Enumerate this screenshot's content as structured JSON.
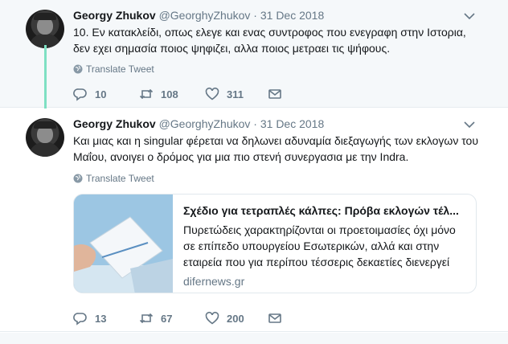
{
  "tweets": [
    {
      "name": "Georgy Zhukov",
      "handle": "@GeorghyZhukov",
      "separator": "·",
      "date": "31 Dec 2018",
      "text": "10. Εν κατακλείδι, οπως ελεγε και ενας συντροφος που ενεγραφη στην Ιστορια, δεν εχει σημασία ποιος ψηφιζει, αλλα ποιος μετραει τις ψήφους.",
      "translate": "Translate Tweet",
      "replies": "10",
      "retweets": "108",
      "likes": "311"
    },
    {
      "name": "Georgy Zhukov",
      "handle": "@GeorghyZhukov",
      "separator": "·",
      "date": "31 Dec 2018",
      "text": "Και μιας και η singular φέρεται να δηλωνει αδυναμία διεξαγωγής των εκλογων του Μαΐου, ανοιγει ο δρόμος για μια πιο στενή συνεργασια με την Indra.",
      "translate": "Translate Tweet",
      "card": {
        "title": "Σχέδιο για τετραπλές κάλπες: Πρόβα εκλογών τέλ...",
        "description": "Πυρετώδεις χαρακτηρίζονται οι προετοιμασίες όχι μόνο σε επίπεδο υπουργείου Εσωτερικών, αλλά και στην εταιρεία που για περίπου τέσσερις δεκαετίες διενεργεί τ...",
        "domain": "difernews.gr"
      },
      "replies": "13",
      "retweets": "67",
      "likes": "200"
    }
  ],
  "icons": {
    "reply": "reply-icon",
    "retweet": "retweet-icon",
    "like": "heart-icon",
    "dm": "envelope-icon",
    "caret": "chevron-down-icon",
    "globe": "globe-icon"
  },
  "colors": {
    "thread_line": "#7ee0c3",
    "secondary_text": "#657786",
    "background_highlight": "#f5f8fa"
  }
}
